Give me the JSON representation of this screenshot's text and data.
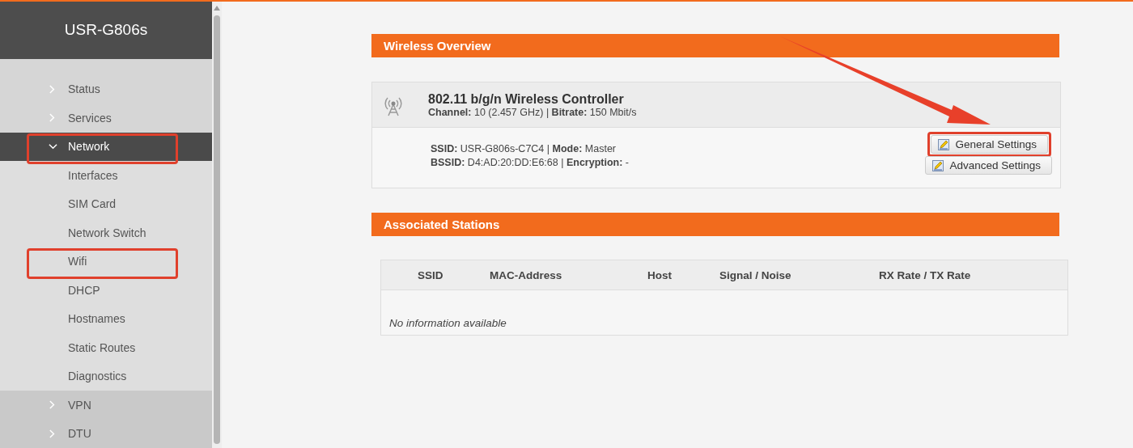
{
  "brand": "USR-G806s",
  "menu": [
    {
      "label": "Status",
      "expanded": false,
      "annotated": false
    },
    {
      "label": "Services",
      "expanded": false,
      "annotated": false
    },
    {
      "label": "Network",
      "expanded": true,
      "annotated": true,
      "children": [
        {
          "label": "Interfaces",
          "annotated": false
        },
        {
          "label": "SIM Card",
          "annotated": false
        },
        {
          "label": "Network Switch",
          "annotated": false
        },
        {
          "label": "Wifi",
          "annotated": true
        },
        {
          "label": "DHCP",
          "annotated": false
        },
        {
          "label": "Hostnames",
          "annotated": false
        },
        {
          "label": "Static Routes",
          "annotated": false
        },
        {
          "label": "Diagnostics",
          "annotated": false
        }
      ]
    },
    {
      "label": "VPN",
      "expanded": false,
      "annotated": false
    },
    {
      "label": "DTU",
      "expanded": false,
      "annotated": false
    }
  ],
  "wireless_overview": {
    "title": "Wireless Overview",
    "device": {
      "name": "802.11 b/g/n Wireless Controller",
      "info": "**Channel:** 10 (2.457 GHz) | **Bitrate:** 150 Mbit/s"
    },
    "network": {
      "lines": [
        "**SSID:** USR-G806s-C7C4 | **Mode:** Master",
        "**BSSID:** D4:AD:20:DD:E6:68 | **Encryption:** -"
      ],
      "buttons": [
        {
          "label": "General Settings",
          "annotated": true
        },
        {
          "label": "Advanced Settings",
          "annotated": false
        }
      ]
    }
  },
  "associated_stations": {
    "title": "Associated Stations",
    "columns": [
      "SSID",
      "MAC-Address",
      "Host",
      "Signal / Noise",
      "RX Rate / TX Rate"
    ],
    "empty_message": "No information available"
  },
  "annotation_arrow": {
    "kind": "arrow"
  }
}
